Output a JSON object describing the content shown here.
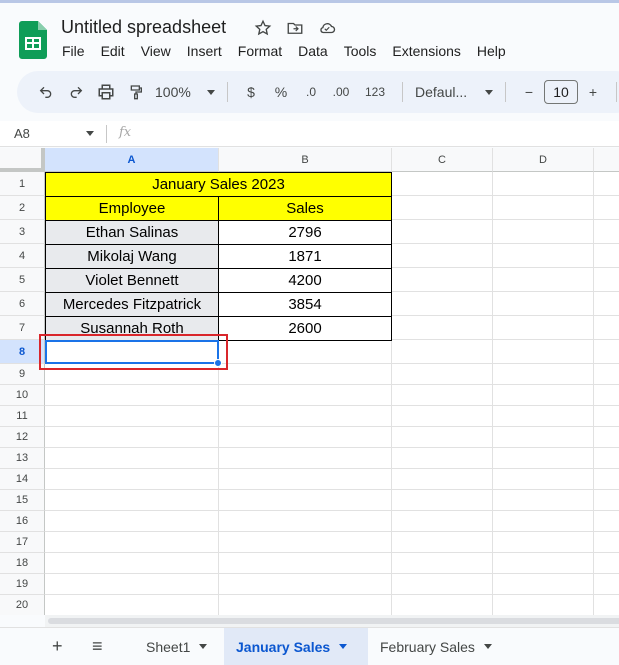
{
  "app": {
    "title": "Untitled spreadsheet",
    "menu": [
      "File",
      "Edit",
      "View",
      "Insert",
      "Format",
      "Data",
      "Tools",
      "Extensions",
      "Help"
    ]
  },
  "toolbar": {
    "zoom": "100%",
    "currency": "$",
    "percent": "%",
    "decrease_decimal": ".0",
    "increase_decimal": ".00",
    "number_format": "123",
    "font_name": "Defaul...",
    "font_size": "10",
    "minus": "−",
    "plus": "+"
  },
  "formula_bar": {
    "name_box": "A8",
    "fx": "fx"
  },
  "grid": {
    "columns": [
      "A",
      "B",
      "C",
      "D"
    ],
    "rows": [
      "1",
      "2",
      "3",
      "4",
      "5",
      "6",
      "7",
      "8",
      "9",
      "10",
      "11",
      "12",
      "13",
      "14",
      "15",
      "16",
      "17",
      "18",
      "19",
      "20"
    ],
    "selected_cell": "A8"
  },
  "table": {
    "title": "January Sales 2023",
    "headers": [
      "Employee",
      "Sales"
    ],
    "rows": [
      {
        "employee": "Ethan Salinas",
        "sales": "2796"
      },
      {
        "employee": "Mikolaj Wang",
        "sales": "1871"
      },
      {
        "employee": "Violet Bennett",
        "sales": "4200"
      },
      {
        "employee": "Mercedes Fitzpatrick",
        "sales": "3854"
      },
      {
        "employee": "Susannah Roth",
        "sales": "2600"
      }
    ]
  },
  "sheets": {
    "add": "+",
    "list_icon": "≡",
    "tabs": [
      "Sheet1",
      "January Sales",
      "February Sales"
    ],
    "active": "January Sales"
  },
  "colors": {
    "header_fill": "#ffff00",
    "name_fill": "#e8eaed",
    "selection": "#1a73e8",
    "highlight_box": "#d9262b"
  }
}
